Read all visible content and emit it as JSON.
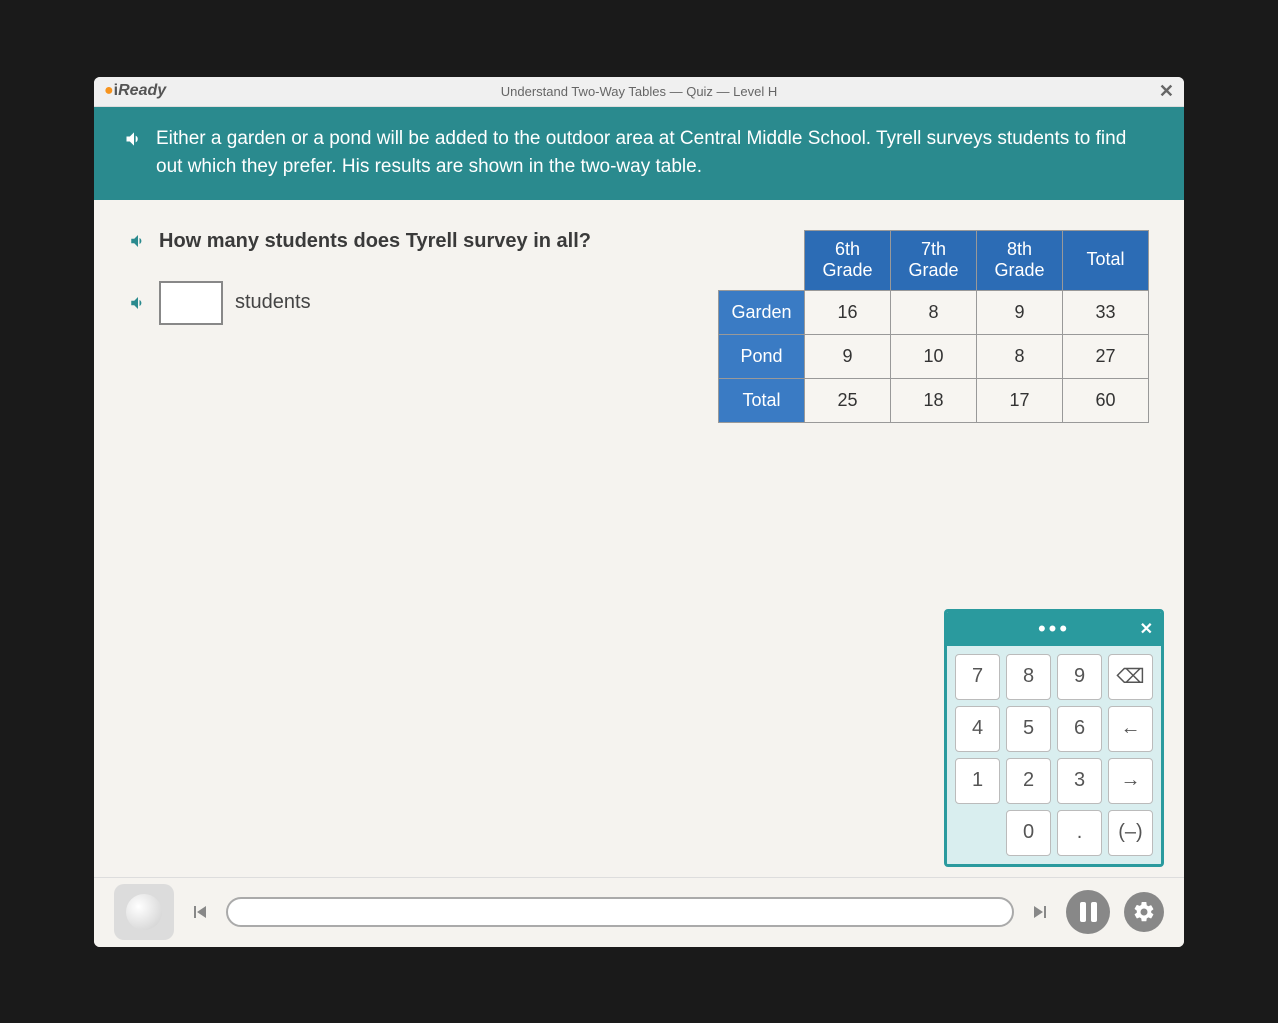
{
  "header": {
    "logo_prefix": "i",
    "logo_suffix": "Ready",
    "lesson_title": "Understand Two-Way Tables — Quiz — Level H"
  },
  "context": "Either a garden or a pond will be added to the outdoor area at Central Middle School. Tyrell surveys students to find out which they prefer. His results are shown in the two-way table.",
  "question": "How many students does Tyrell survey in all?",
  "answer": {
    "value": "",
    "unit": "students"
  },
  "table": {
    "col_headers": [
      "6th\nGrade",
      "7th\nGrade",
      "8th\nGrade",
      "Total"
    ],
    "rows": [
      {
        "label": "Garden",
        "cells": [
          "16",
          "8",
          "9",
          "33"
        ]
      },
      {
        "label": "Pond",
        "cells": [
          "9",
          "10",
          "8",
          "27"
        ]
      },
      {
        "label": "Total",
        "cells": [
          "25",
          "18",
          "17",
          "60"
        ]
      }
    ]
  },
  "keypad": {
    "keys": [
      [
        "7",
        "8",
        "9",
        "⌫"
      ],
      [
        "4",
        "5",
        "6",
        "←"
      ],
      [
        "1",
        "2",
        "3",
        "→"
      ],
      [
        "",
        "0",
        ".",
        "(–)"
      ]
    ]
  },
  "chart_data": {
    "type": "table",
    "title": "Two-way table: Garden vs Pond preference by grade",
    "columns": [
      "6th Grade",
      "7th Grade",
      "8th Grade",
      "Total"
    ],
    "rows": [
      "Garden",
      "Pond",
      "Total"
    ],
    "values": [
      [
        16,
        8,
        9,
        33
      ],
      [
        9,
        10,
        8,
        27
      ],
      [
        25,
        18,
        17,
        60
      ]
    ]
  }
}
